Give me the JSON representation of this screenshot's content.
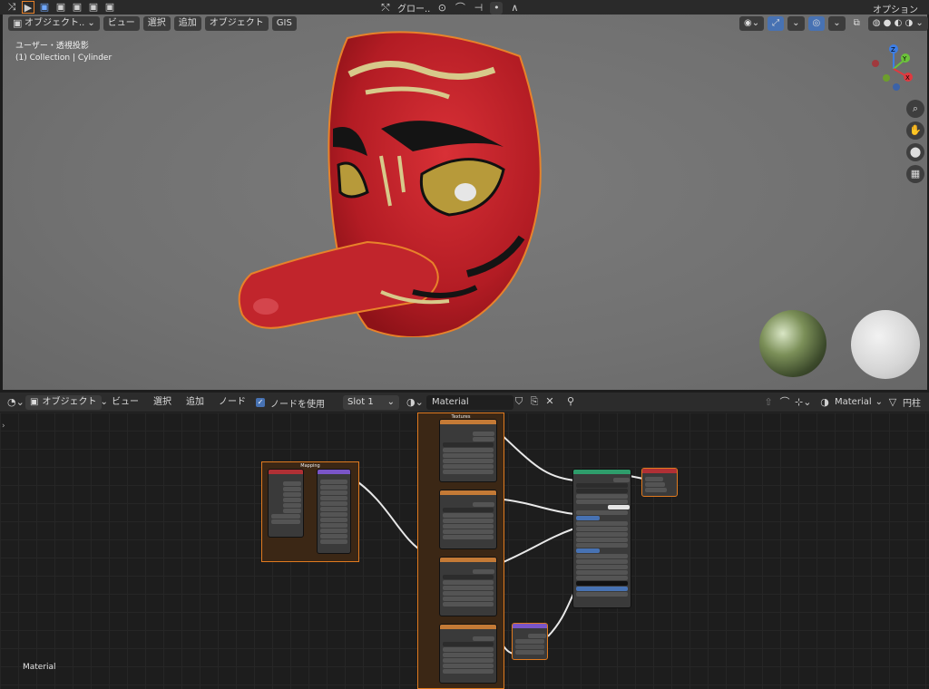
{
  "top_bar": {
    "transform_orientation": "グロー..",
    "options": "オプション"
  },
  "viewport_header": {
    "mode": "オブジェクト..",
    "menus": [
      "ビュー",
      "選択",
      "追加",
      "オブジェクト",
      "GIS"
    ]
  },
  "viewport": {
    "view_name": "ユーザー・透視投影",
    "collection": "(1) Collection | Cylinder",
    "gizmo_axes": [
      "Z",
      "Y",
      "X"
    ],
    "accent": "#e8822a"
  },
  "node_header": {
    "mode": "オブジェクト",
    "menus": [
      "ビュー",
      "選択",
      "追加",
      "ノード"
    ],
    "use_nodes_label": "ノードを使用",
    "use_nodes": true,
    "slot": "Slot 1",
    "material": "Material",
    "material_right": "Material",
    "object_right": "円柱"
  },
  "node_editor": {
    "footer_label": "Material",
    "frames": [
      {
        "label": "Mapping"
      },
      {
        "label": "Textures"
      }
    ]
  }
}
